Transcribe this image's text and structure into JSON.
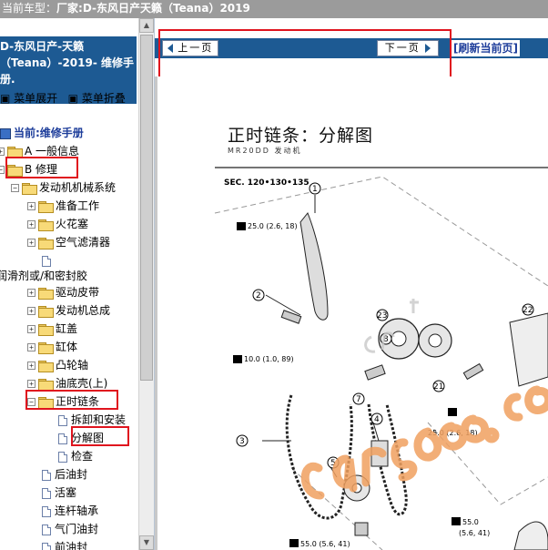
{
  "topbar": {
    "label": "当前车型：",
    "model": "厂家:D-东风日产天籁（Teana）2019"
  },
  "book": {
    "line1": "D-东风日产-天籁",
    "line2": "（Teana）-2019- 维修手",
    "line3": "册."
  },
  "menu": {
    "expand": "菜单展开",
    "collapse": "菜单折叠"
  },
  "tree": {
    "current": "当前:维修手册",
    "a": "A 一般信息",
    "b": "B 修理",
    "engine": "发动机机械系统",
    "prep": "准备工作",
    "spark": "火花塞",
    "air": "空气滤清器",
    "lube": "润滑剂或/和密封胶",
    "belt": "驱动皮带",
    "assy": "发动机总成",
    "cover": "缸盖",
    "block": "缸体",
    "cam": "凸轮轴",
    "pan": "油底壳(上)",
    "chain": "正时链条",
    "remove": "拆卸和安装",
    "exploded": "分解图",
    "inspect": "检查",
    "rear_seal": "后油封",
    "piston": "活塞",
    "rod": "连杆轴承",
    "valve": "气门油封",
    "front_seal": "前油封"
  },
  "nav": {
    "prev": "上一页",
    "next": "下一页",
    "refresh": "[刷新当前页]"
  },
  "diagram": {
    "title": "正时链条：分解图",
    "engine_code": "MR20DD",
    "engine_label": "发动机",
    "sec": "SEC. 120•130•135",
    "torque1": "25.0 (2.6, 18)",
    "torque2": "10.0 (1.0, 89)",
    "torque3": "25.0 (2.6, 18)",
    "torque4": "55.0 (5.6, 41)",
    "torque5": "55.0",
    "torque6": "(5.6, 41)"
  },
  "colors": {
    "nav_bg": "#1d5a93",
    "highlight": "#e0141e",
    "link": "#1d3d9a",
    "watermark": "#f0a060"
  }
}
